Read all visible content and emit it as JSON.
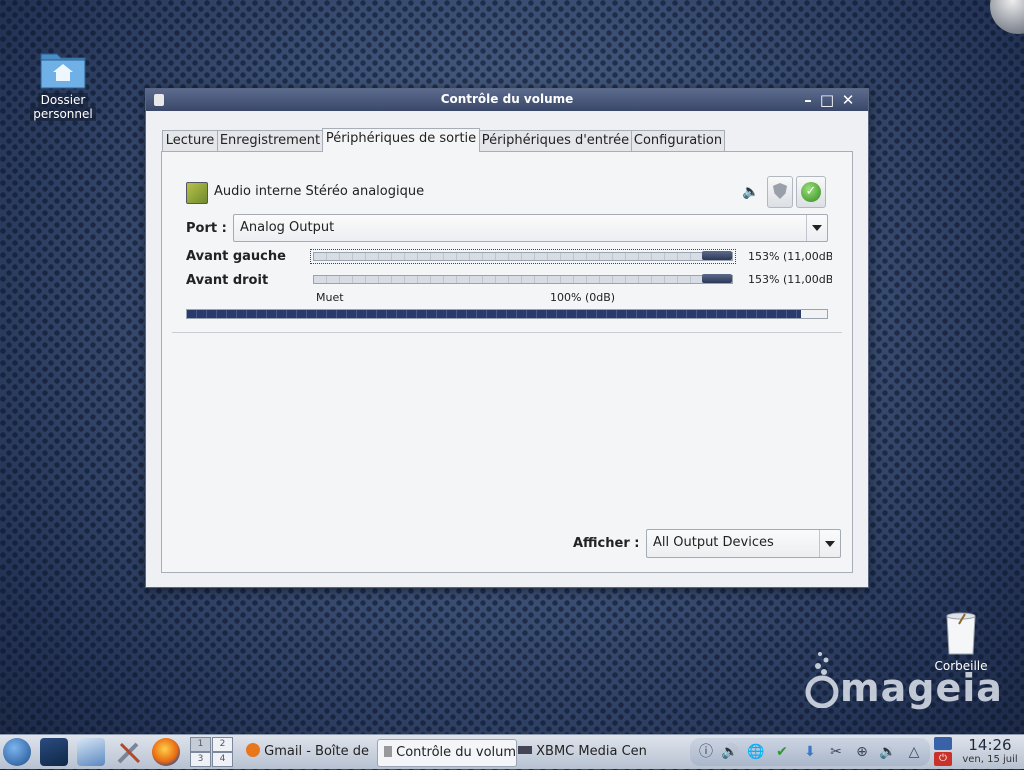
{
  "desktop": {
    "home_folder_label_1": "Dossier",
    "home_folder_label_2": "personnel",
    "trash_label": "Corbeille",
    "brand": "mageia"
  },
  "window": {
    "title": "Contrôle du volume",
    "tabs": [
      {
        "label": "Lecture"
      },
      {
        "label": "Enregistrement"
      },
      {
        "label": "Périphériques de sortie"
      },
      {
        "label": "Périphériques d'entrée"
      },
      {
        "label": "Configuration"
      }
    ],
    "active_tab_index": 2,
    "device": {
      "name": "Audio interne Stéréo analogique",
      "port_label": "Port :",
      "port_value": "Analog Output",
      "channels": [
        {
          "label": "Avant gauche",
          "value_text": "153% (11,00dB)",
          "level": 153
        },
        {
          "label": "Avant droit",
          "value_text": "153% (11,00dB)",
          "level": 153
        }
      ],
      "scale_min_label": "Muet",
      "scale_mid_label": "100% (0dB)",
      "peak_meter_fraction": 0.96,
      "lock_channels_checked": true
    },
    "show_label": "Afficher :",
    "show_value": "All Output Devices"
  },
  "taskbar": {
    "pager": [
      "1",
      "2",
      "3",
      "4"
    ],
    "tasks": [
      {
        "label": "Gmail - Boîte de réception"
      },
      {
        "label": "Contrôle du volume"
      },
      {
        "label": "XBMC Media Center"
      }
    ],
    "clock_time": "14:26",
    "clock_date": "ven, 15 juil"
  },
  "colors": {
    "titlebar": "#3a4768",
    "accent_handle": "#2c3858",
    "desktop_bg": "#3b4f74"
  }
}
